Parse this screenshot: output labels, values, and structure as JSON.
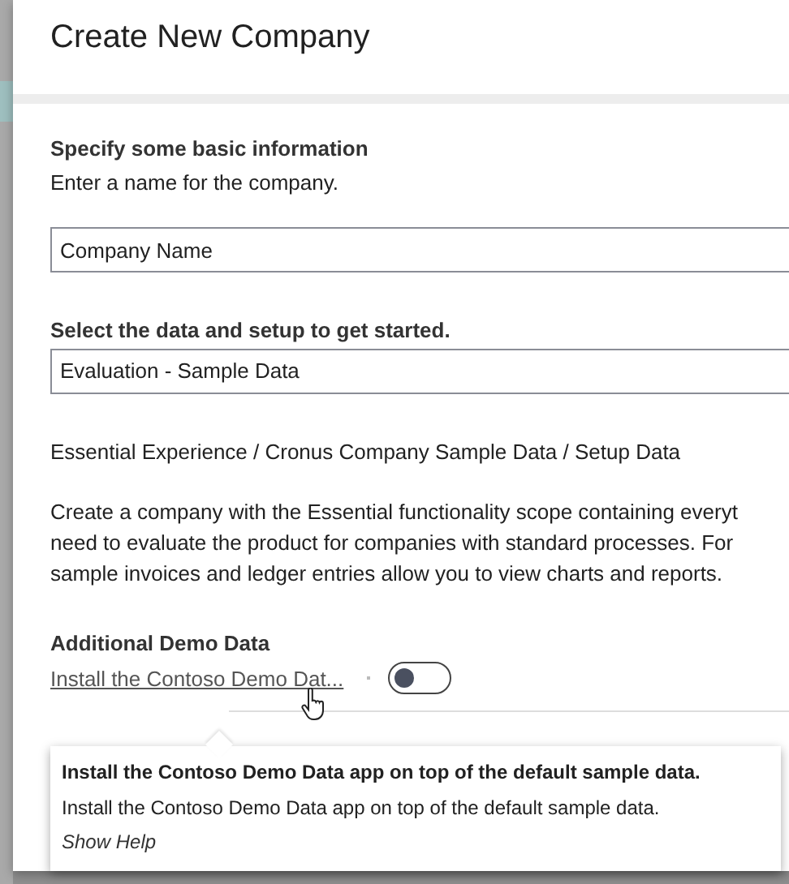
{
  "dialog": {
    "title": "Create New Company"
  },
  "basic_info": {
    "heading": "Specify some basic information",
    "instruction": "Enter a name for the company.",
    "name_field": {
      "value": "Company Name"
    }
  },
  "data_setup": {
    "label": "Select the data and setup to get started.",
    "selected_value": "Evaluation - Sample Data",
    "summary": "Essential Experience / Cronus Company Sample Data / Setup Data",
    "description_lines": [
      "Create a company with the Essential functionality scope containing everyt",
      "need to evaluate the product for companies with standard processes. For",
      "sample invoices and ledger entries allow you to view charts and reports."
    ]
  },
  "additional_demo_data": {
    "heading": "Additional Demo Data",
    "link": "Install the Contoso Demo Dat...",
    "toggle": {
      "on": false
    }
  },
  "tooltip": {
    "title": "Install the Contoso Demo Data app on top of the default sample data.",
    "text": "Install the Contoso Demo Data app on top of the default sample data.",
    "help_link": "Show Help"
  }
}
